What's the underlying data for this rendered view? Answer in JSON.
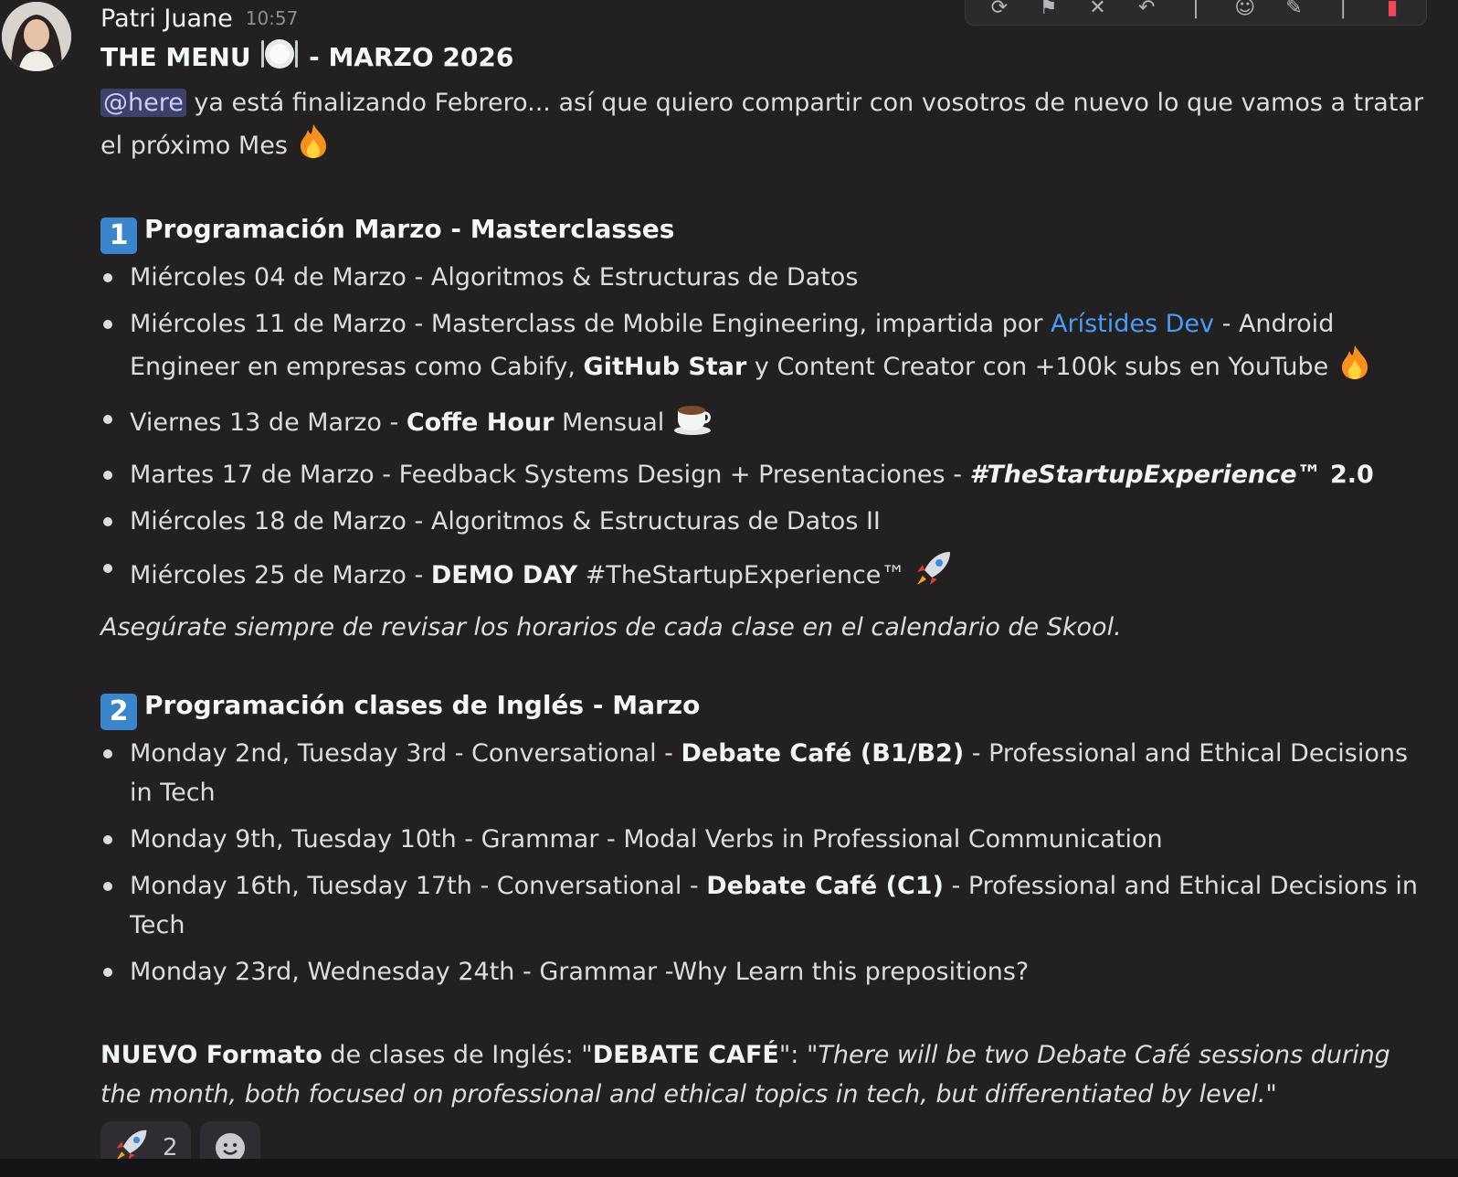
{
  "message": {
    "author": "Patri Juane",
    "time": "10:57",
    "title_start": "THE MENU",
    "title_end": "- MARZO 2026",
    "intro_mention": "@here",
    "intro_text": " ya está finalizando Febrero... así que quiero compartir con vosotros de nuevo lo que vamos a tratar el próximo Mes ",
    "section1": {
      "number": "1",
      "title": "Programación Marzo - Masterclasses",
      "items": [
        {
          "text": "Miércoles 04 de Marzo - Algoritmos & Estructuras de Datos"
        },
        {
          "pre": "Miércoles 11 de Marzo - Masterclass de Mobile Engineering, impartida por ",
          "link": "Arístides Dev",
          "mid": " - Android Engineer en empresas como Cabify, ",
          "bold": "GitHub Star",
          "post": " y Content Creator con +100k subs en YouTube "
        },
        {
          "pre": "Viernes 13 de Marzo - ",
          "bold": "Coffe Hour",
          "post": " Mensual "
        },
        {
          "pre": "Martes 17 de Marzo - Feedback Systems Design + Presentaciones - ",
          "bolditalic": "#TheStartupExperience™",
          "bold": " 2.0"
        },
        {
          "text": "Miércoles 18 de Marzo - Algoritmos & Estructuras de Datos II"
        },
        {
          "pre": "Miércoles 25 de Marzo - ",
          "bold": "DEMO DAY",
          "post": " #TheStartupExperience™ "
        }
      ],
      "note": "Asegúrate siempre de revisar los horarios de cada clase en el calendario de Skool."
    },
    "section2": {
      "number": "2",
      "title": "Programación clases de Inglés - Marzo",
      "items": [
        {
          "pre": "Monday 2nd, Tuesday 3rd  - Conversational - ",
          "bold": "Debate Café (B1/B2)",
          "post": " - Professional and Ethical Decisions in Tech"
        },
        {
          "text": "Monday 9th, Tuesday 10th  - Grammar - Modal Verbs in Professional Communication"
        },
        {
          "pre": "Monday 16th, Tuesday 17th - Conversational - ",
          "bold": "Debate Café (C1)",
          "post": " - Professional and Ethical Decisions in Tech"
        },
        {
          "text": "Monday 23rd, Wednesday 24th  - Grammar -Why Learn this prepositions?"
        }
      ]
    },
    "final": {
      "bold1": "NUEVO Formato",
      "text1": " de clases de Inglés: \"",
      "bold2": "DEBATE CAFÉ",
      "text2": "\": ",
      "quote": "\"There will be two Debate Café sessions during the month, both focused on professional and ethical topics in tech, but differentiated by level.\""
    }
  },
  "reactions": [
    {
      "emoji": "rocket-emoji",
      "count": "2"
    }
  ],
  "toolbar": {
    "icons": [
      "refresh-icon",
      "thumbs-count-icon",
      "pin-icon",
      "reply-icon",
      "more-icon",
      "emoji-icon",
      "edit-icon",
      "more-icon",
      "delete-icon"
    ]
  },
  "colors": {
    "background": "#222021",
    "mention_bg": "#3e426a",
    "link": "#4a9df7",
    "badge": "#3a85cb"
  }
}
